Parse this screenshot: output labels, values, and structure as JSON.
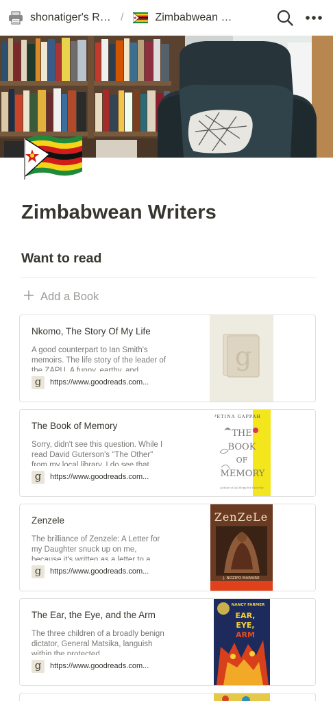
{
  "topbar": {
    "workspace": "shonatiger's Re...",
    "separator": "/",
    "page": "Zimbabwean W..."
  },
  "page": {
    "title": "Zimbabwean Writers",
    "section_title": "Want to read",
    "add_label": "Add a Book"
  },
  "icons": {
    "workspace": "printer-icon",
    "page": "zimbabwe-flag-icon",
    "search": "search-icon",
    "more": "more-icon",
    "add": "plus-icon",
    "favicon": "goodreads-icon"
  },
  "colors": {
    "text": "#37352f",
    "muted": "#787774",
    "placeholder": "#9b9a97",
    "border": "#dfdfdd"
  },
  "cards": [
    {
      "title": "Nkomo, The Story Of My Life",
      "desc": "A good counterpart to Ian Smith's memoirs. The life story of the leader of the ZAPU. A funny, earthy, and",
      "url": "https://www.goodreads.com...",
      "thumb_alt": "g"
    },
    {
      "title": "The Book of Memory",
      "desc": "Sorry, didn't see this question. While I read David Guterson's \"The Other\" from my local library, I do see that",
      "url": "https://www.goodreads.com...",
      "cover_author": "PETINA GAPPAH",
      "cover_title_1": "THE",
      "cover_title_2": "BOOK",
      "cover_title_3": "OF",
      "cover_title_4": "MEMORY"
    },
    {
      "title": "Zenzele",
      "desc": "The brilliance of Zenzele: A Letter for my Daughter snuck up on me, because it's written as a letter to a",
      "url": "https://www.goodreads.com...",
      "cover_title": "ZenZeLe",
      "cover_author": "J. NOZIPO MARAIRE"
    },
    {
      "title": "The Ear, the Eye, and the Arm",
      "desc": "The three children of a broadly benign dictator, General Matsika, languish within the protected",
      "url": "https://www.goodreads.com...",
      "cover_author": "NANCY FARMER",
      "cover_title_1": "EAR,",
      "cover_title_2": "EYE,",
      "cover_title_3": "ARM"
    }
  ]
}
